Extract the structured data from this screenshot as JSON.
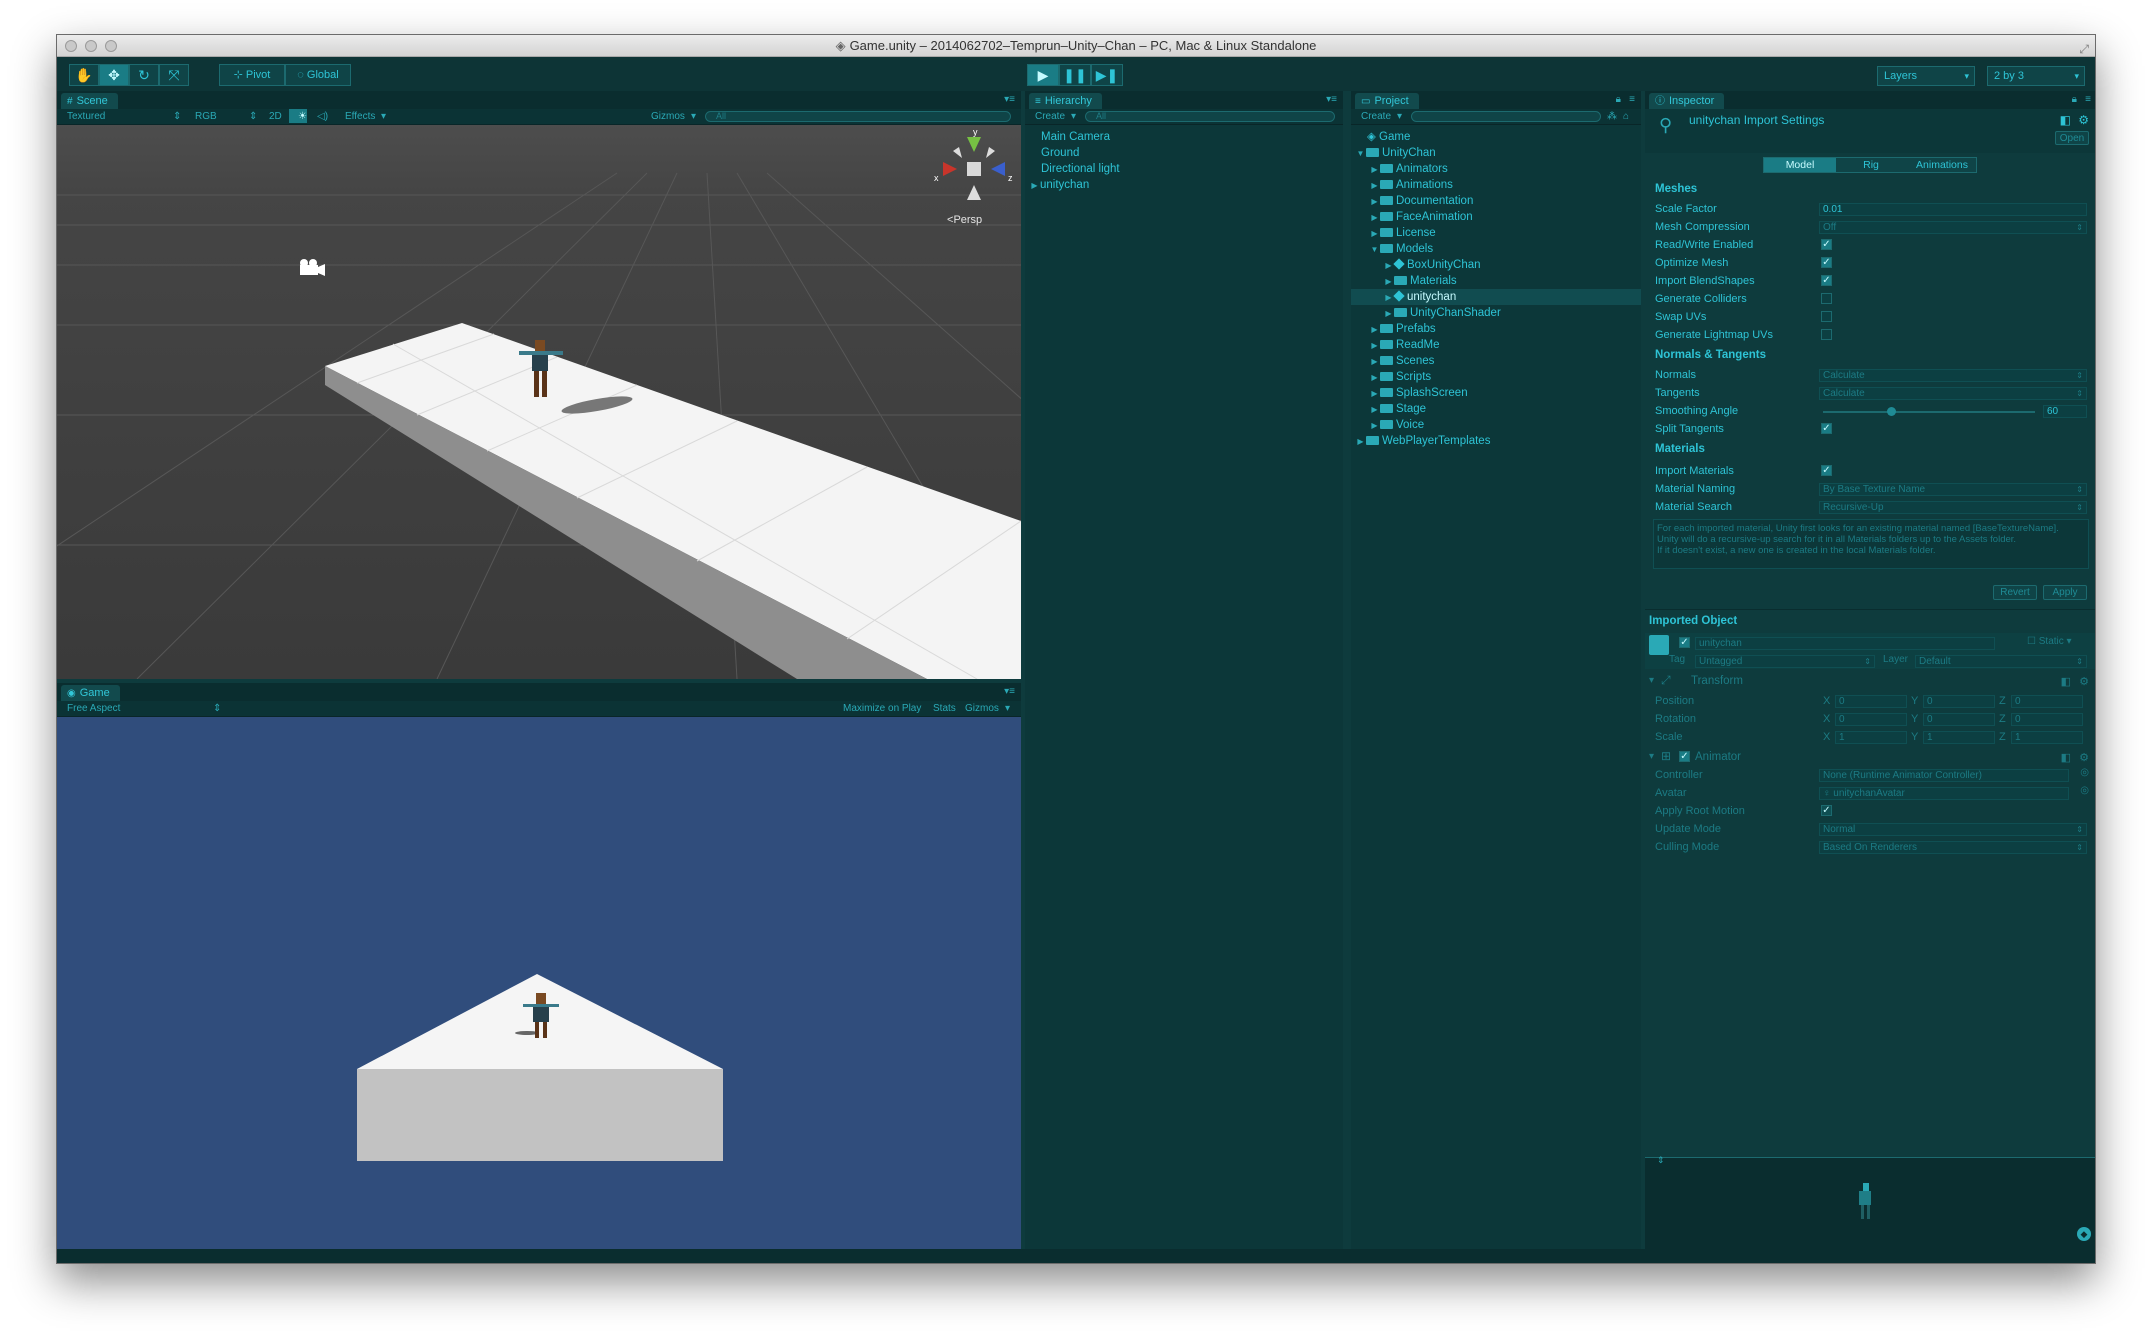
{
  "window": {
    "title": "Game.unity – 2014062702–Temprun–Unity–Chan – PC, Mac & Linux Standalone"
  },
  "toolbar": {
    "pivot": "Pivot",
    "global": "Global",
    "layers": "Layers",
    "layout": "2 by 3"
  },
  "scene": {
    "tab": "Scene",
    "shading": "Textured",
    "render_mode": "RGB",
    "mode_2d": "2D",
    "effects": "Effects",
    "gizmos": "Gizmos",
    "search_placeholder": "All",
    "persp": "Persp",
    "axis_x": "x",
    "axis_y": "y",
    "axis_z": "z"
  },
  "game": {
    "tab": "Game",
    "aspect": "Free Aspect",
    "maximize": "Maximize on Play",
    "stats": "Stats",
    "gizmos": "Gizmos"
  },
  "hierarchy": {
    "tab": "Hierarchy",
    "create": "Create",
    "search_placeholder": "All",
    "items": [
      "Main Camera",
      "Ground",
      "Directional light",
      "unitychan"
    ]
  },
  "project": {
    "tab": "Project",
    "create": "Create",
    "items": [
      {
        "label": "Game",
        "depth": 0,
        "kind": "scene"
      },
      {
        "label": "UnityChan",
        "depth": 0,
        "kind": "folder"
      },
      {
        "label": "Animators",
        "depth": 1,
        "kind": "folder"
      },
      {
        "label": "Animations",
        "depth": 1,
        "kind": "folder"
      },
      {
        "label": "Documentation",
        "depth": 1,
        "kind": "folder"
      },
      {
        "label": "FaceAnimation",
        "depth": 1,
        "kind": "folder"
      },
      {
        "label": "License",
        "depth": 1,
        "kind": "folder"
      },
      {
        "label": "Models",
        "depth": 1,
        "kind": "folder"
      },
      {
        "label": "BoxUnityChan",
        "depth": 2,
        "kind": "model"
      },
      {
        "label": "Materials",
        "depth": 2,
        "kind": "folder"
      },
      {
        "label": "unitychan",
        "depth": 2,
        "kind": "model"
      },
      {
        "label": "UnityChanShader",
        "depth": 2,
        "kind": "folder"
      },
      {
        "label": "Prefabs",
        "depth": 1,
        "kind": "folder"
      },
      {
        "label": "ReadMe",
        "depth": 1,
        "kind": "folder"
      },
      {
        "label": "Scenes",
        "depth": 1,
        "kind": "folder"
      },
      {
        "label": "Scripts",
        "depth": 1,
        "kind": "folder"
      },
      {
        "label": "SplashScreen",
        "depth": 1,
        "kind": "folder"
      },
      {
        "label": "Stage",
        "depth": 1,
        "kind": "folder"
      },
      {
        "label": "Voice",
        "depth": 1,
        "kind": "folder"
      },
      {
        "label": "WebPlayerTemplates",
        "depth": 0,
        "kind": "folder"
      }
    ]
  },
  "inspector": {
    "tab": "Inspector",
    "title": "unitychan Import Settings",
    "open": "Open",
    "tabs": [
      "Model",
      "Rig",
      "Animations"
    ],
    "meshes": "Meshes",
    "scale_factor_label": "Scale Factor",
    "scale_factor": "0.01",
    "mesh_compression_label": "Mesh Compression",
    "mesh_compression": "Off",
    "read_write_label": "Read/Write Enabled",
    "optimize_mesh_label": "Optimize Mesh",
    "import_blendshapes_label": "Import BlendShapes",
    "generate_colliders_label": "Generate Colliders",
    "swap_uvs_label": "Swap UVs",
    "lightmap_uvs_label": "Generate Lightmap UVs",
    "normals_tangents": "Normals & Tangents",
    "normals_label": "Normals",
    "normals": "Calculate",
    "tangents_label": "Tangents",
    "tangents": "Calculate",
    "smoothing_label": "Smoothing Angle",
    "smoothing": "60",
    "split_tangents_label": "Split Tangents",
    "materials": "Materials",
    "import_materials_label": "Import Materials",
    "material_naming_label": "Material Naming",
    "material_naming": "By Base Texture Name",
    "material_search_label": "Material Search",
    "material_search": "Recursive-Up",
    "help_text": "For each imported material, Unity first looks for an existing material named [BaseTextureName].\nUnity will do a recursive-up search for it in all Materials folders up to the Assets folder.\nIf it doesn't exist, a new one is created in the local Materials folder.",
    "revert": "Revert",
    "apply": "Apply",
    "imported_object": "Imported Object",
    "object_name": "unitychan",
    "static": "Static",
    "tag_label": "Tag",
    "tag": "Untagged",
    "layer_label": "Layer",
    "layer": "Default",
    "transform": "Transform",
    "position_label": "Position",
    "rotation_label": "Rotation",
    "scale_label": "Scale",
    "x": "X",
    "y": "Y",
    "z": "Z",
    "position": [
      "0",
      "0",
      "0"
    ],
    "rotation": [
      "0",
      "0",
      "0"
    ],
    "scale": [
      "1",
      "1",
      "1"
    ],
    "animator": "Animator",
    "controller_label": "Controller",
    "controller": "None (Runtime Animator Controller)",
    "avatar_label": "Avatar",
    "avatar": "unitychanAvatar",
    "root_motion_label": "Apply Root Motion",
    "update_mode_label": "Update Mode",
    "update_mode": "Normal",
    "culling_label": "Culling Mode",
    "culling": "Based On Renderers"
  }
}
